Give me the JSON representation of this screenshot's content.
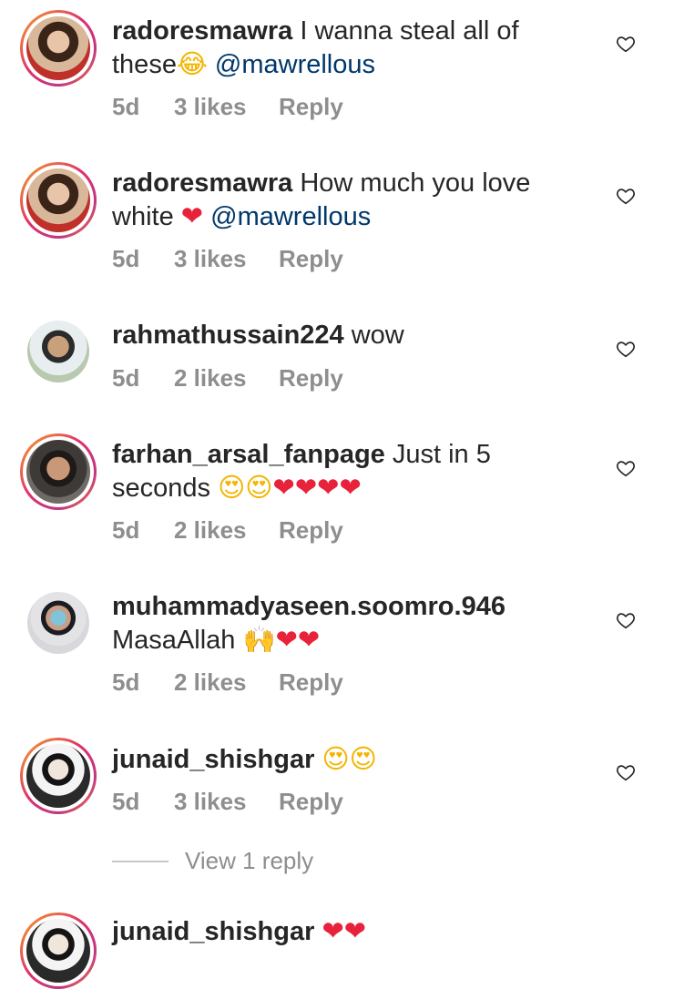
{
  "comments": [
    {
      "username": "radoresmawra",
      "text": " I wanna steal all of these",
      "emoji": "😂",
      "emoji_kind": "face",
      "mention": " @mawrellous",
      "time": "5d",
      "likes": "3 likes",
      "reply": "Reply"
    },
    {
      "username": "radoresmawra",
      "text": " How much you love white ",
      "emoji": "❤",
      "emoji_kind": "heart",
      "mention": " @mawrellous",
      "time": "5d",
      "likes": "3 likes",
      "reply": "Reply"
    },
    {
      "username": "rahmathussain224",
      "text": " wow",
      "emoji": "",
      "mention": "",
      "time": "5d",
      "likes": "2 likes",
      "reply": "Reply"
    },
    {
      "username": "farhan_arsal_fanpage",
      "text": " Just in 5 seconds ",
      "emoji_faces": "😍😍",
      "emoji_hearts": "❤❤❤❤",
      "time": "5d",
      "likes": "2 likes",
      "reply": "Reply"
    },
    {
      "username": "muhammadyaseen.soomro.946",
      "text": " MasaAllah ",
      "emoji_faces": "🙌",
      "emoji_hearts": "❤❤",
      "time": "5d",
      "likes": "2 likes",
      "reply": "Reply"
    },
    {
      "username": "junaid_shishgar",
      "text": " ",
      "emoji_faces": "😍😍",
      "emoji_hearts": "",
      "time": "5d",
      "likes": "3 likes",
      "reply": "Reply"
    }
  ],
  "view_replies": "View 1 reply",
  "partial_comment": {
    "username": "junaid_shishgar",
    "emoji_hearts": "❤❤"
  },
  "icons": {
    "like": "heart-outline-icon"
  },
  "colors": {
    "mention": "#00376b",
    "meta": "#8e8e8e",
    "heart": "#e8223a"
  }
}
